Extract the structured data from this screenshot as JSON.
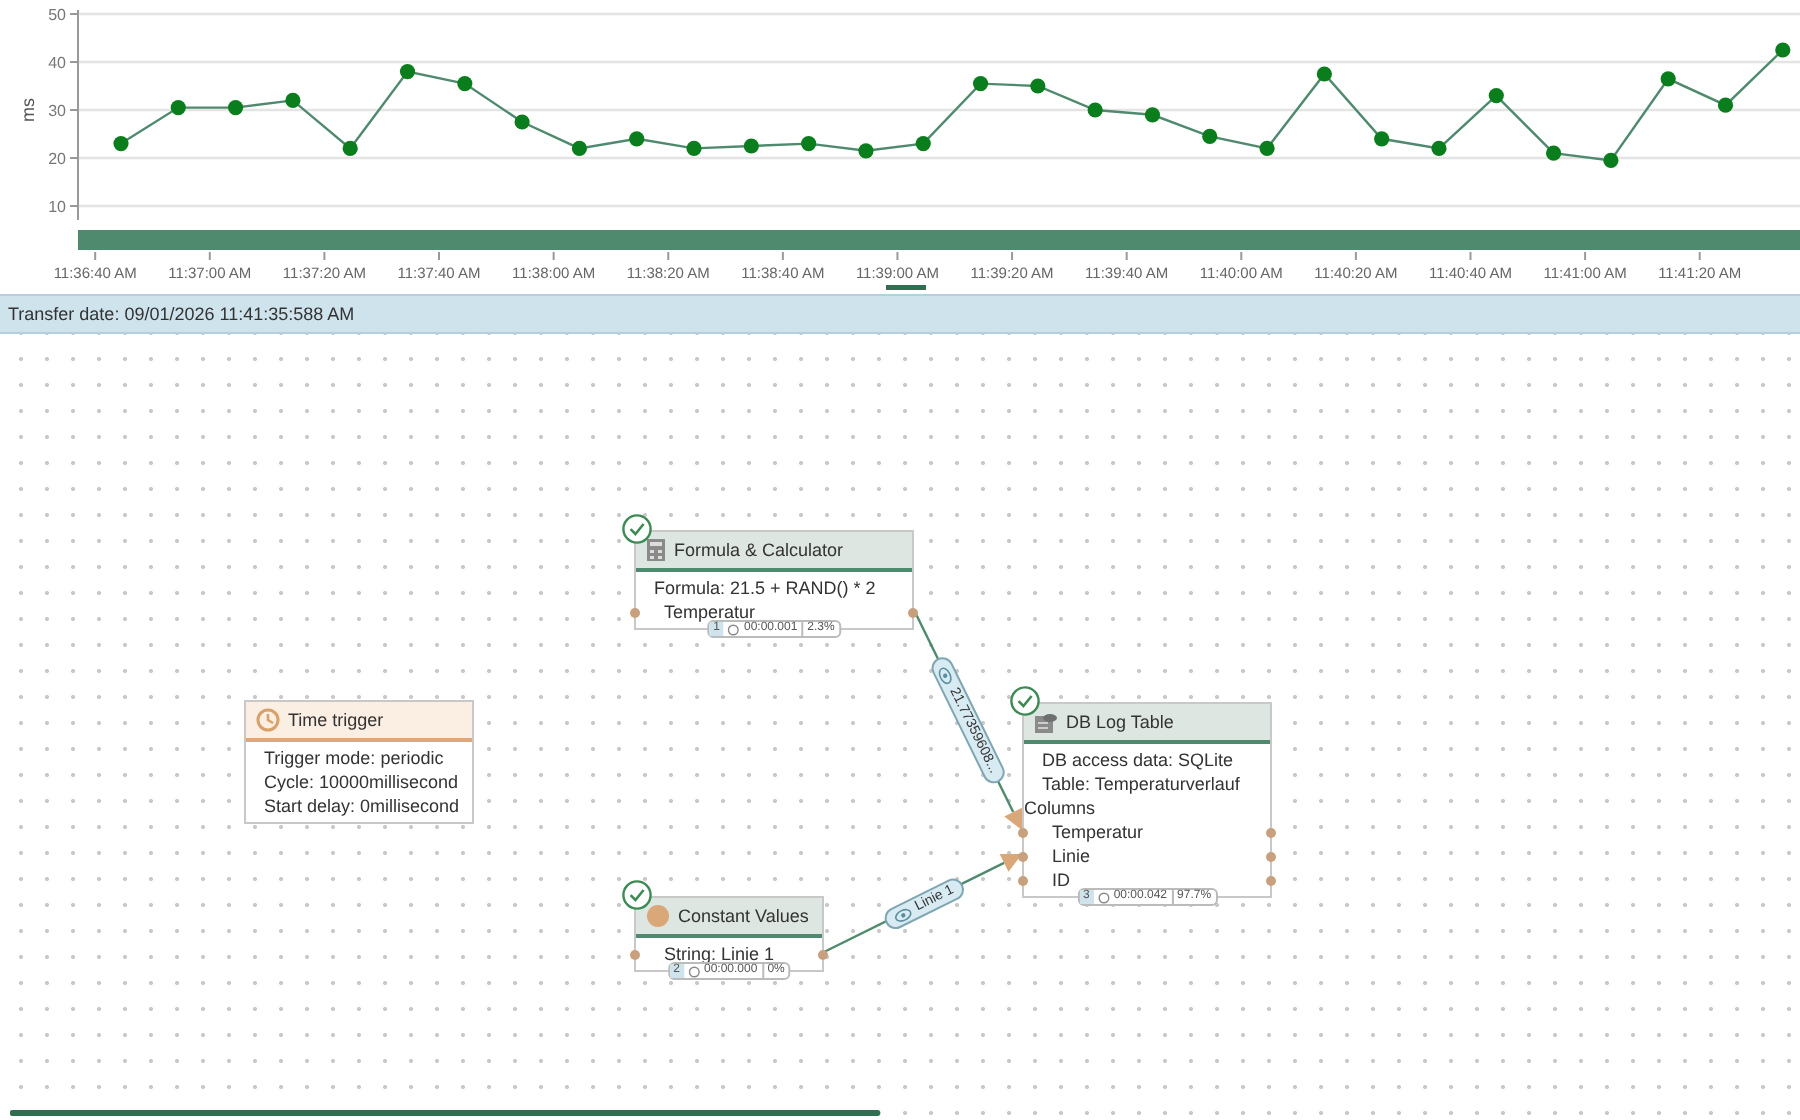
{
  "chart": {
    "chart_data": {
      "type": "line",
      "ylabel": "ms",
      "grid": true,
      "x": [
        41804.5,
        41814.5,
        41824.5,
        41834.5,
        41844.5,
        41854.5,
        41864.5,
        41874.5,
        41884.5,
        41894.5,
        41904.5,
        41914.5,
        41924.5,
        41934.5,
        41944.5,
        41954.5,
        41964.5,
        41974.5,
        41984.5,
        41994.5,
        42004.5,
        42014.5,
        42024.5,
        42034.5,
        42044.5,
        42054.5,
        42064.5,
        42074.5,
        42084.5,
        42094.5
      ],
      "series": [
        {
          "color": "#0a7d1c",
          "marker": true,
          "values": [
            23,
            30.5,
            30.5,
            32,
            22,
            38,
            35.5,
            27.5,
            22,
            24,
            22,
            22.5,
            23,
            21.5,
            23,
            35.5,
            35,
            30,
            29,
            24.5,
            22,
            37.5,
            24,
            22,
            33,
            21,
            19.5,
            36.5,
            31,
            42.5
          ]
        }
      ],
      "xlim": [
        41797,
        42097.5
      ],
      "ylim": [
        10,
        50
      ],
      "yticks": [
        10,
        20,
        30,
        40,
        50
      ],
      "xticks": [
        {
          "value": 41800,
          "label": "11:36:40 AM"
        },
        {
          "value": 41820,
          "label": "11:37:00 AM"
        },
        {
          "value": 41840,
          "label": "11:37:20 AM"
        },
        {
          "value": 41860,
          "label": "11:37:40 AM"
        },
        {
          "value": 41880,
          "label": "11:38:00 AM"
        },
        {
          "value": 41900,
          "label": "11:38:20 AM"
        },
        {
          "value": 41920,
          "label": "11:38:40 AM"
        },
        {
          "value": 41940,
          "label": "11:39:00 AM"
        },
        {
          "value": 41960,
          "label": "11:39:20 AM"
        },
        {
          "value": 41980,
          "label": "11:39:40 AM"
        },
        {
          "value": 42000,
          "label": "11:40:00 AM"
        },
        {
          "value": 42020,
          "label": "11:40:20 AM"
        },
        {
          "value": 42040,
          "label": "11:40:40 AM"
        },
        {
          "value": 42060,
          "label": "11:41:00 AM"
        },
        {
          "value": 42080,
          "label": "11:41:20 AM"
        }
      ]
    }
  },
  "status": {
    "transfer_date": "Transfer date: 09/01/2026 11:41:35:588 AM"
  },
  "nodes": [
    {
      "kind": "process",
      "title": "Formula & Calculator",
      "succeeded": true,
      "lines": [
        {
          "kind": "property",
          "text": "Formula: 21.5 + RAND() * 2"
        },
        {
          "kind": "port",
          "text": "Temperatur"
        }
      ],
      "footer": {
        "index": "1",
        "duration": "00:00.001",
        "share": "2.3%"
      }
    },
    {
      "kind": "trigger",
      "title": "Time trigger",
      "succeeded": false,
      "lines": [
        {
          "kind": "property",
          "text": "Trigger mode: periodic"
        },
        {
          "kind": "property",
          "text": "Cycle: 10000millisecond"
        },
        {
          "kind": "property",
          "text": "Start delay: 0millisecond"
        }
      ]
    },
    {
      "kind": "process",
      "title": "DB Log Table",
      "succeeded": true,
      "lines": [
        {
          "kind": "property",
          "text": "DB access data: SQLite"
        },
        {
          "kind": "property",
          "text": "Table: Temperaturverlauf"
        },
        {
          "kind": "section",
          "text": "Columns"
        },
        {
          "kind": "port",
          "text": "Temperatur"
        },
        {
          "kind": "port",
          "text": "Linie"
        },
        {
          "kind": "port",
          "text": "ID"
        }
      ],
      "footer": {
        "index": "3",
        "duration": "00:00.042",
        "share": "97.7%"
      }
    },
    {
      "kind": "process",
      "title": "Constant Values",
      "succeeded": true,
      "lines": [
        {
          "kind": "port",
          "text": "String: Linie 1"
        }
      ],
      "footer": {
        "index": "2",
        "duration": "00:00.000",
        "share": "0%"
      }
    }
  ],
  "edges": [
    {
      "label": "21.77359608..."
    },
    {
      "label": "Linie 1"
    }
  ]
}
